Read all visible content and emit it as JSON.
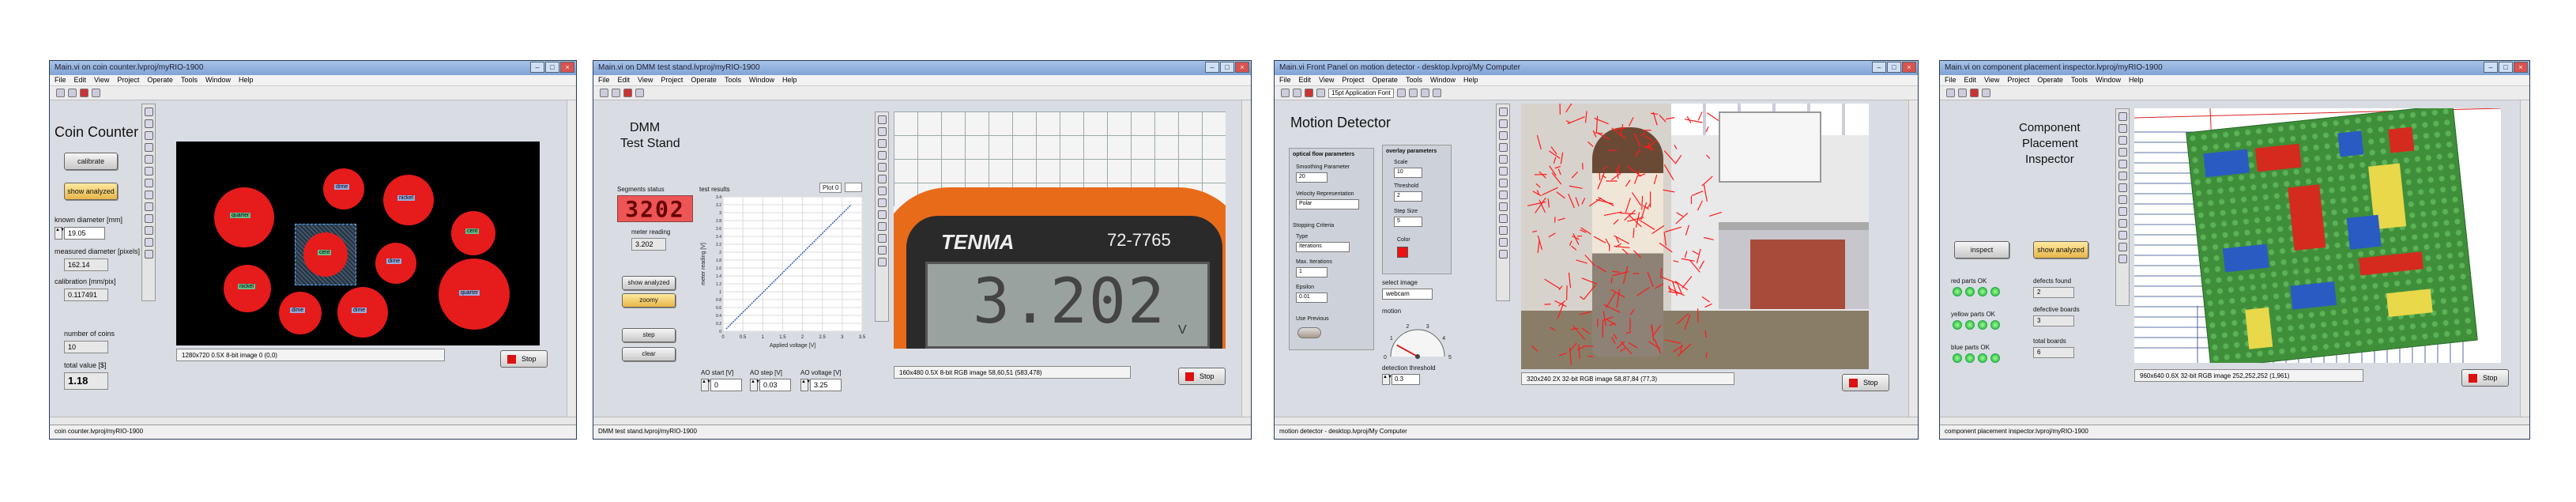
{
  "menu": [
    "File",
    "Edit",
    "View",
    "Project",
    "Operate",
    "Tools",
    "Window",
    "Help"
  ],
  "stop_label": "Stop",
  "w1": {
    "title": "Main.vi on coin counter.lvproj/myRIO-1900",
    "heading": "Coin Counter",
    "calibrate": "calibrate",
    "show_analyzed": "show analyzed",
    "known_diameter_label": "known diameter [mm]",
    "known_diameter": "19.05",
    "measured_diameter_label": "measured diameter [pixels]",
    "measured_diameter": "162.14",
    "calibration_label": "calibration [mm/pix]",
    "calibration": "0.117491",
    "number_of_coins_label": "number of coins",
    "number_of_coins": "10",
    "total_value_label": "total value [$]",
    "total_value": "1.18",
    "image_info": "1280x720 0.5X 8-bit image 0    (0,0)",
    "status": "coin counter.lvproj/myRIO-1900",
    "coins": [
      "quarter",
      "dime",
      "nickel",
      "dime",
      "cent",
      "dime",
      "cent",
      "dime",
      "nickel",
      "quarter"
    ]
  },
  "w2": {
    "title": "Main.vi on DMM test stand.lvproj/myRIO-1900",
    "heading_line1": "DMM",
    "heading_line2": "Test Stand",
    "segments_label": "Segments status",
    "segments": "3202",
    "test_results_label": "test results",
    "plot_label": "Plot 0",
    "meter_reading_label": "meter reading",
    "meter_reading": "3.202",
    "show_analyzed": "show analyzed",
    "zoomy": "zoomy",
    "step": "step",
    "clear": "clear",
    "ao_start_label": "AO start [V]",
    "ao_start": "0",
    "ao_step_label": "AO step [V]",
    "ao_step": "0.03",
    "ao_voltage_label": "AO voltage [V]",
    "ao_voltage": "3.25",
    "xlabel": "Applied voltage [V]",
    "ylabel": "meter reading [V]",
    "x_ticks": [
      "0",
      "0.5",
      "1",
      "1.5",
      "2",
      "2.5",
      "3",
      "3.5"
    ],
    "y_ticks": [
      "0",
      "0.2",
      "0.4",
      "0.6",
      "0.8",
      "1",
      "1.2",
      "1.4",
      "1.6",
      "1.8",
      "2",
      "2.2",
      "2.4",
      "2.6",
      "2.8",
      "3",
      "3.2",
      "3.4"
    ],
    "brand": "TENMA",
    "model": "72-7765",
    "display": "3.202",
    "display_unit": "V",
    "image_info": "160x480 0.5X 8-bit RGB image 58,60,51    (583,478)",
    "status": "DMM test stand.lvproj/myRIO-1900"
  },
  "w3": {
    "title": "Main.vi Front Panel on motion detector - desktop.lvproj/My Computer",
    "font": "15pt Application Font",
    "heading": "Motion Detector",
    "ofp_title": "optical flow parameters",
    "smoothing_label": "Smoothing Parameter",
    "smoothing": "20",
    "velocity_label": "Velocity Representation",
    "velocity": "Polar",
    "stopping_label": "Stopping Criteria",
    "type_label": "Type",
    "type": "Iterations",
    "max_iter_label": "Max. Iterations",
    "max_iter": "1",
    "epsilon_label": "Epsilon",
    "epsilon": "0.01",
    "use_previous_label": "Use Previous",
    "overlay_title": "overlay parameters",
    "scale_label": "Scale",
    "scale": "10",
    "threshold_label": "Threshold",
    "threshold": "2",
    "step_size_label": "Step Size",
    "step_size": "5",
    "color_label": "Color",
    "select_image_label": "select image",
    "select_image": "webcam",
    "motion_label": "motion",
    "gauge_ticks": [
      "0",
      "1",
      "2",
      "3",
      "4",
      "5"
    ],
    "detection_threshold_label": "detection threshold",
    "detection_threshold": "0.3",
    "image_info": "320x240 2X 32-bit RGB image 58,87,84    (77,3)",
    "status": "motion detector - desktop.lvproj/My Computer",
    "motion_value": 0.8
  },
  "w4": {
    "title": "Main.vi on component placement inspector.lvproj/myRIO-1900",
    "heading_line1": "Component",
    "heading_line2": "Placement",
    "heading_line3": "Inspector",
    "inspect": "inspect",
    "show_analyzed": "show analyzed",
    "red_parts_label": "red parts OK",
    "yellow_parts_label": "yellow parts OK",
    "blue_parts_label": "blue parts OK",
    "defects_found_label": "defects found",
    "defects_found": "2",
    "defective_boards_label": "defective boards",
    "defective_boards": "3",
    "total_boards_label": "total boards",
    "total_boards": "6",
    "image_info": "960x640 0.6X 32-bit RGB image 252,252,252    (1,961)",
    "status": "component placement inspector.lvproj/myRIO-1900"
  },
  "colors": {
    "coin": "#e61b1b",
    "lego_green": "#3f8f3a",
    "lego_red": "#d42b1e",
    "lego_blue": "#2a5bc2",
    "lego_yellow": "#e8d84a"
  }
}
